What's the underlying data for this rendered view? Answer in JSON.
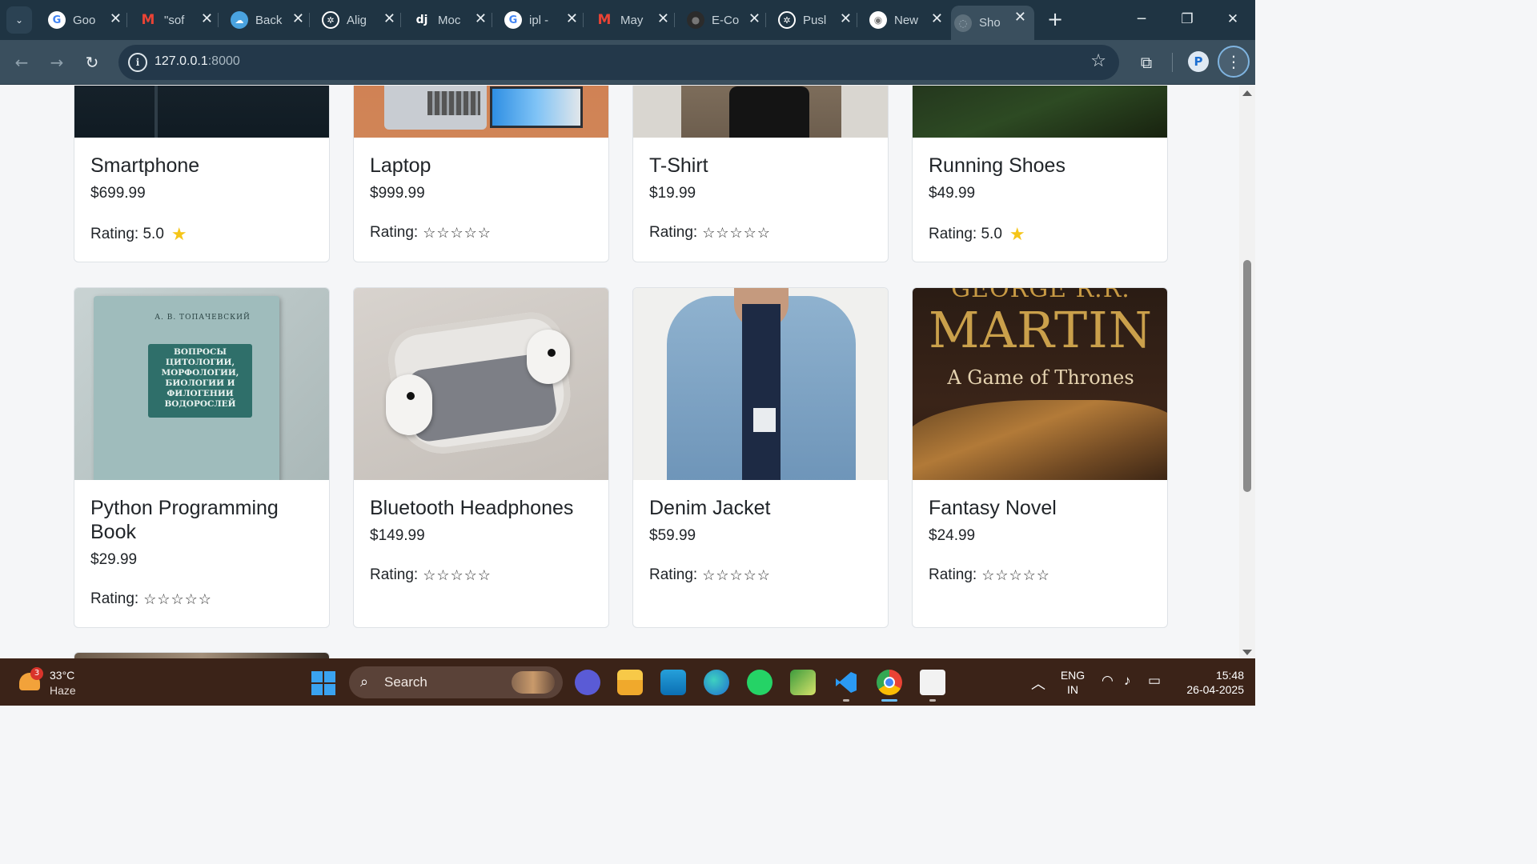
{
  "browser": {
    "tabs": [
      {
        "title": "Goo",
        "favicon": "google-icon"
      },
      {
        "title": "\"sof",
        "favicon": "gmail-icon"
      },
      {
        "title": "Back",
        "favicon": "cloud-icon"
      },
      {
        "title": "Alig",
        "favicon": "openai-icon"
      },
      {
        "title": "Moc",
        "favicon": "django-icon"
      },
      {
        "title": "ipl -",
        "favicon": "google-icon"
      },
      {
        "title": "May",
        "favicon": "gmail-icon"
      },
      {
        "title": "E-Co",
        "favicon": "github-icon"
      },
      {
        "title": "Pusl",
        "favicon": "openai-icon"
      },
      {
        "title": "New",
        "favicon": "chrome-icon"
      },
      {
        "title": "Sho",
        "favicon": "globe-icon",
        "active": true
      }
    ],
    "url_host": "127.0.0.1",
    "url_port": ":8000"
  },
  "products_top": [
    {
      "name": "Smartphone",
      "price": "$699.99",
      "rating_label": "Rating: 5.0",
      "rating": 5.0
    },
    {
      "name": "Laptop",
      "price": "$999.99",
      "rating_label": "Rating:",
      "stars": "☆☆☆☆☆"
    },
    {
      "name": "T-Shirt",
      "price": "$19.99",
      "rating_label": "Rating:",
      "stars": "☆☆☆☆☆"
    },
    {
      "name": "Running Shoes",
      "price": "$49.99",
      "rating_label": "Rating: 5.0",
      "rating": 5.0
    }
  ],
  "products_mid": [
    {
      "name": "Python Programming Book",
      "price": "$29.99",
      "rating_label": "Rating:",
      "stars": "☆☆☆☆☆",
      "image_text": {
        "author": "А. В. ТОПАЧЕВСКИЙ",
        "title": "Вопросы цитологии, морфологии, биологии и филогении водорослей"
      }
    },
    {
      "name": "Bluetooth Headphones",
      "price": "$149.99",
      "rating_label": "Rating:",
      "stars": "☆☆☆☆☆"
    },
    {
      "name": "Denim Jacket",
      "price": "$59.99",
      "rating_label": "Rating:",
      "stars": "☆☆☆☆☆"
    },
    {
      "name": "Fantasy Novel",
      "price": "$24.99",
      "rating_label": "Rating:",
      "stars": "☆☆☆☆☆",
      "image_text": {
        "author_top": "GEORGE R.R.",
        "author": "MARTIN",
        "title": "A Game of Thrones"
      }
    }
  ],
  "taskbar": {
    "weather_temp": "33°C",
    "weather_condition": "Haze",
    "weather_badge": "3",
    "search_label": "Search",
    "language_top": "ENG",
    "language_bottom": "IN",
    "time": "15:48",
    "date": "26-04-2025"
  },
  "colors": {
    "tabstrip": "#1f3443",
    "toolbar": "#3a4f5e",
    "star_filled": "#f5c518",
    "taskbar": "#3b2318"
  }
}
